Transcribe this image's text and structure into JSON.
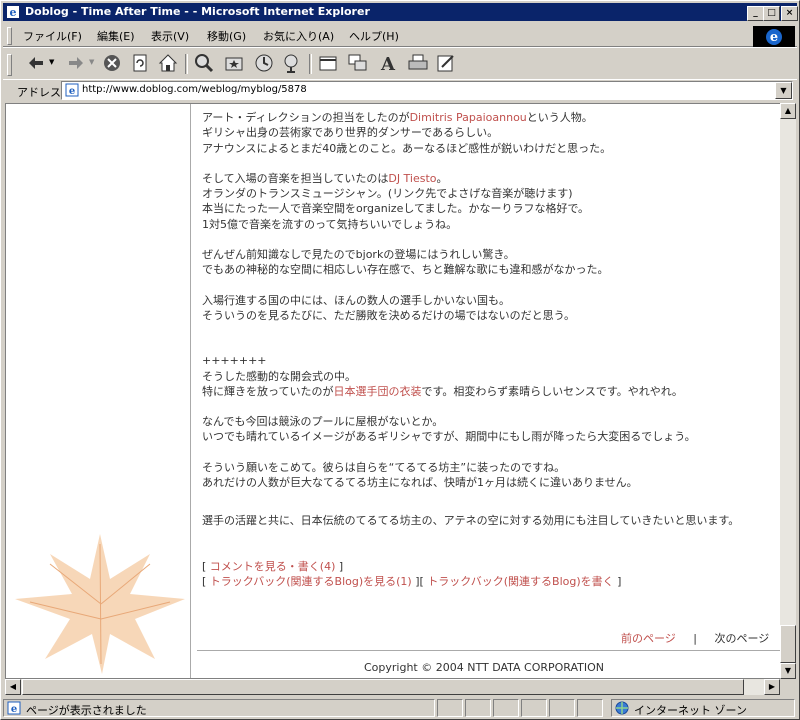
{
  "window": {
    "title": "Doblog - Time After Time - - Microsoft Internet Explorer"
  },
  "menu": [
    "ファイル(F)",
    "編集(E)",
    "表示(V)",
    "移動(G)",
    "お気に入り(A)",
    "ヘルプ(H)"
  ],
  "address": {
    "label": "アドレス",
    "url": "http://www.doblog.com/weblog/myblog/5878"
  },
  "article": {
    "p1": {
      "l1a": "アート・ディレクションの担当をしたのが",
      "l1link": "Dimitris Papaioannou",
      "l1b": "という人物。",
      "l2": "ギリシャ出身の芸術家であり世界的ダンサーであるらしい。",
      "l3": "アナウンスによるとまだ40歳とのこと。あーなるほど感性が鋭いわけだと思った。"
    },
    "p2": {
      "l1a": "そして入場の音楽を担当していたのは",
      "l1link": "DJ Tiesto",
      "l1b": "。",
      "l2": "オランダのトランスミュージシャン。(リンク先でよさげな音楽が聴けます)",
      "l3": "本当にたった一人で音楽空間をorganizeしてました。かなーりラフな格好で。",
      "l4": "1対5億で音楽を流すのって気持ちいいでしょうね。"
    },
    "p3": {
      "l1": "ぜんぜん前知識なしで見たのでbjorkの登場にはうれしい驚き。",
      "l2": "でもあの神秘的な空間に相応しい存在感で、ちと難解な歌にも違和感がなかった。"
    },
    "p4": {
      "l1": "入場行進する国の中には、ほんの数人の選手しかいない国も。",
      "l2": "そういうのを見るたびに、ただ勝敗を決めるだけの場ではないのだと思う。"
    },
    "p5": {
      "sep": "+++++++",
      "l1": "そうした感動的な開会式の中。",
      "l2a": "特に輝きを放っていたのが",
      "l2link": "日本選手団の衣装",
      "l2b": "です。相変わらず素晴らしいセンスです。やれやれ。"
    },
    "p6": {
      "l1": "なんでも今回は競泳のプールに屋根がないとか。",
      "l2": "いつでも晴れているイメージがあるギリシャですが、期間中にもし雨が降ったら大変困るでしょう。"
    },
    "p7": {
      "l1": "そういう願いをこめて。彼らは自らを“てるてる坊主”に装ったのですね。",
      "l2": "あれだけの人数が巨大なてるてる坊主になれば、快晴が1ヶ月は続くに違いありません。"
    },
    "p8": {
      "l1": "選手の活躍と共に、日本伝統のてるてる坊主の、アテネの空に対する効用にも注目していきたいと思います。"
    }
  },
  "links": {
    "comments": "コメントを見る・書く(4)",
    "tb_view": "トラックバック(関連するBlog)を見る(1)",
    "tb_write": "トラックバック(関連するBlog)を書く"
  },
  "nav": {
    "prev": "前のページ",
    "sep": "|",
    "next": "次のページ"
  },
  "copyright": "Copyright © 2004 NTT DATA CORPORATION",
  "status": {
    "left": "ページが表示されました",
    "zone": "インターネット ゾーン"
  },
  "colors": {
    "titlebar": "#0a246a",
    "link": "#c0504d",
    "text": "#333333"
  }
}
